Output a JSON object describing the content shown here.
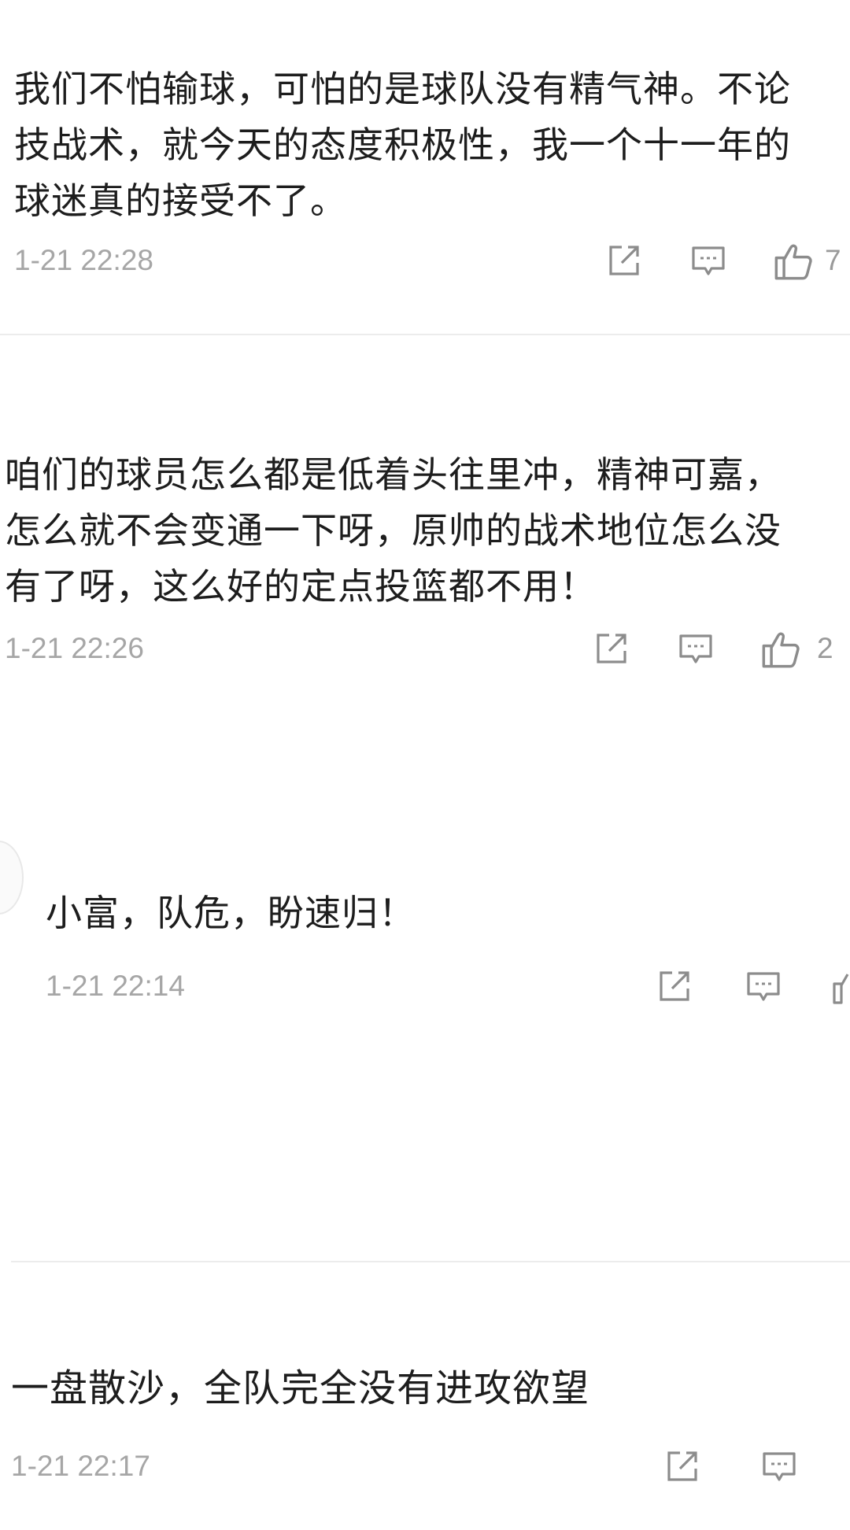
{
  "comments": [
    {
      "text": "我们不怕输球，可怕的是球队没有精气神。不论\n技战术，就今天的态度积极性，我一个十一年的\n球迷真的接受不了。",
      "time": "1-21 22:28",
      "likes": "7"
    },
    {
      "text": "咱们的球员怎么都是低着头往里冲，精神可嘉，\n怎么就不会变通一下呀，原帅的战术地位怎么没\n有了呀，这么好的定点投篮都不用！",
      "time": "1-21 22:26",
      "likes": "2"
    },
    {
      "text": "小富，队危，盼速归！",
      "time": "1-21 22:14"
    },
    {
      "text": "一盘散沙，全队完全没有进攻欲望",
      "time": "1-21 22:17"
    }
  ],
  "icons": {
    "share": "share-icon",
    "reply": "comment-icon",
    "like": "thumbs-up-icon"
  },
  "colors": {
    "text": "#1d1d1d",
    "meta": "#a6a6a6",
    "icon": "#8c8c8c",
    "divider": "#ececec"
  }
}
